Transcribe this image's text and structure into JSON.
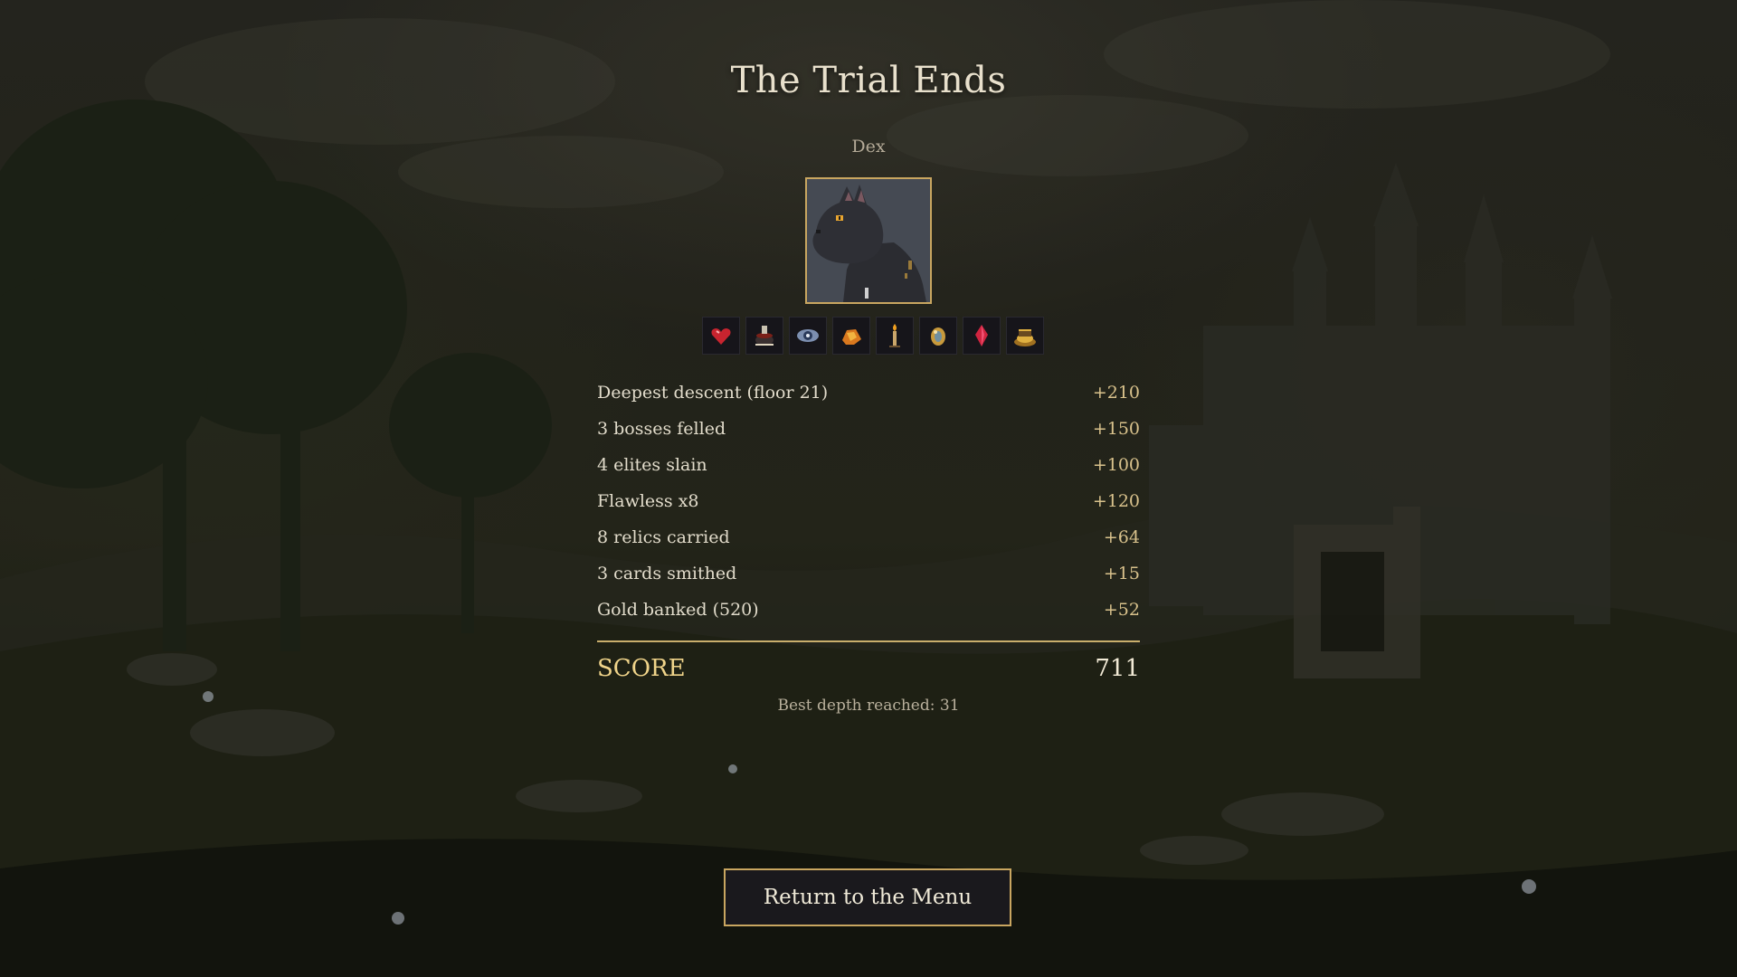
{
  "screen": {
    "title": "The Trial Ends",
    "character_name": "Dex"
  },
  "portrait": {
    "subject": "black-cat-portrait"
  },
  "relics": [
    {
      "icon": "heart-gem-icon"
    },
    {
      "icon": "cauldron-icon"
    },
    {
      "icon": "all-seeing-eye-icon"
    },
    {
      "icon": "ember-stone-icon"
    },
    {
      "icon": "candle-icon"
    },
    {
      "icon": "amber-orb-icon"
    },
    {
      "icon": "red-crystal-icon"
    },
    {
      "icon": "treasure-pile-icon"
    }
  ],
  "breakdown": [
    {
      "label": "Deepest descent  (floor 21)",
      "value": "+210"
    },
    {
      "label": "3 bosses felled",
      "value": "+150"
    },
    {
      "label": "4 elites slain",
      "value": "+100"
    },
    {
      "label": "Flawless x8",
      "value": "+120"
    },
    {
      "label": "8 relics carried",
      "value": "+64"
    },
    {
      "label": "3 cards smithed",
      "value": "+15"
    },
    {
      "label": "Gold banked  (520)",
      "value": "+52"
    }
  ],
  "score": {
    "label": "SCORE",
    "value": "711"
  },
  "best_depth": "Best depth reached: 31",
  "actions": {
    "return_label": "Return to the Menu"
  },
  "colors": {
    "accent_gold": "#c9a660",
    "score_gold": "#f0d48a",
    "text_light": "#e2dccb"
  }
}
